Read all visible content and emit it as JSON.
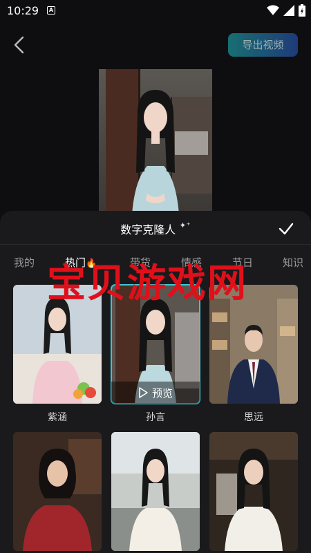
{
  "status_bar": {
    "time": "10:29",
    "notification_letter": "A"
  },
  "header": {
    "export_label": "导出视频"
  },
  "sheet": {
    "title": "数字克隆人",
    "tabs": [
      {
        "label": "我的"
      },
      {
        "label": "热门"
      },
      {
        "label": "带货"
      },
      {
        "label": "情感"
      },
      {
        "label": "节日"
      },
      {
        "label": "知识"
      }
    ],
    "avatars": [
      {
        "name": "紫涵"
      },
      {
        "name": "孙言",
        "preview_label": "预览"
      },
      {
        "name": "思远"
      },
      {
        "name": ""
      },
      {
        "name": ""
      },
      {
        "name": ""
      }
    ]
  },
  "watermark": {
    "text": "宝贝游戏网"
  },
  "colors": {
    "accent": "#3cc8d2",
    "export_gradient_start": "#1c8f93",
    "export_gradient_end": "#244a9c",
    "watermark": "#e0101a"
  }
}
